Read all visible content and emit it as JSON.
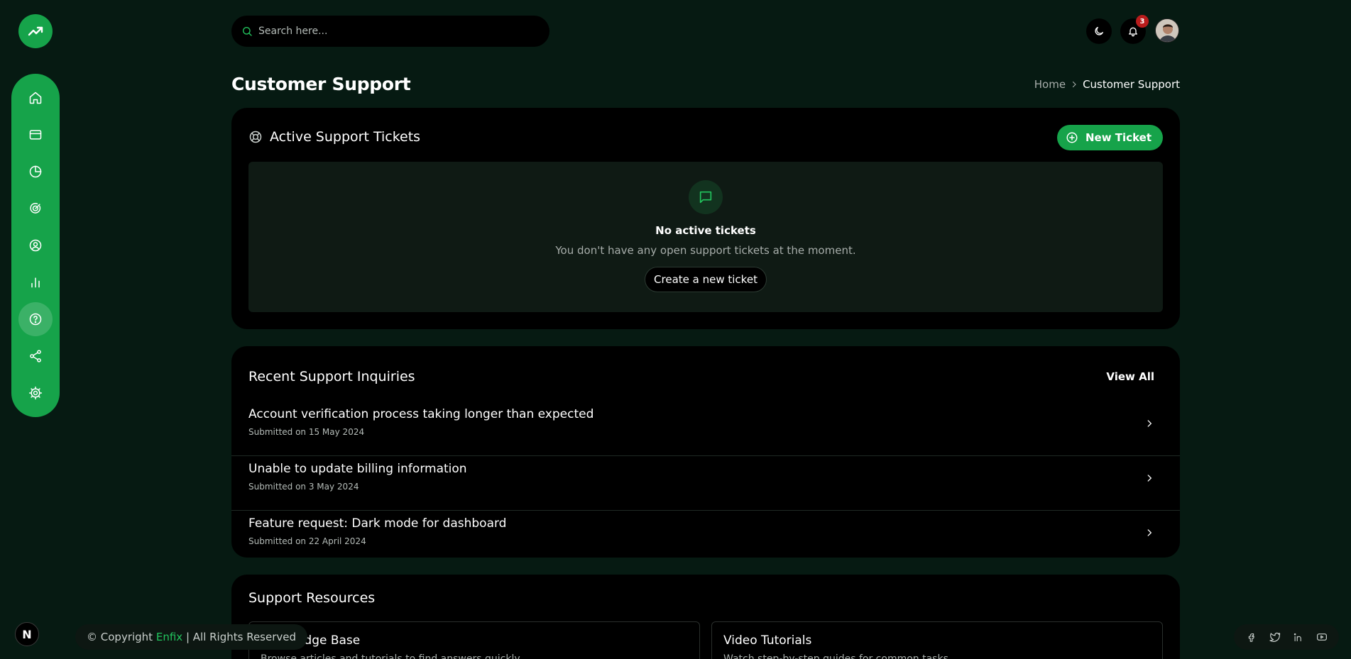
{
  "search": {
    "placeholder": "Search here..."
  },
  "header": {
    "notification_count": "3"
  },
  "page": {
    "title": "Customer Support",
    "breadcrumb": {
      "home": "Home",
      "separator": ">",
      "current": "Customer Support"
    }
  },
  "sidebar": {
    "items": [
      {
        "name": "home-icon"
      },
      {
        "name": "credit-card-icon"
      },
      {
        "name": "pie-chart-icon"
      },
      {
        "name": "radar-icon"
      },
      {
        "name": "user-circle-icon"
      },
      {
        "name": "bar-chart-icon"
      },
      {
        "name": "help-circle-icon",
        "active": true
      },
      {
        "name": "share-icon"
      },
      {
        "name": "settings-icon"
      }
    ]
  },
  "tickets": {
    "title": "Active Support Tickets",
    "new_ticket_label": "New Ticket",
    "empty_title": "No active tickets",
    "empty_subtitle": "You don't have any open support tickets at the moment.",
    "create_label": "Create a new ticket"
  },
  "inquiries": {
    "title": "Recent Support Inquiries",
    "view_all_label": "View All",
    "items": [
      {
        "title": "Account verification process taking longer than expected",
        "date": "Submitted on 15 May 2024"
      },
      {
        "title": "Unable to update billing information",
        "date": "Submitted on 3 May 2024"
      },
      {
        "title": "Feature request: Dark mode for dashboard",
        "date": "Submitted on 22 April 2024"
      }
    ]
  },
  "resources": {
    "title": "Support Resources",
    "items": [
      {
        "title": "Knowledge Base",
        "description": "Browse articles and tutorials to find answers quickly"
      },
      {
        "title": "Video Tutorials",
        "description": "Watch step-by-step guides for common tasks"
      }
    ]
  },
  "footer": {
    "copyright_prefix": "© Copyright",
    "brand": "Enfix",
    "copyright_suffix": "| All Rights Reserved",
    "next_badge": "N"
  },
  "colors": {
    "background": "#061a12",
    "accent": "#16a34a",
    "card": "#000000",
    "badge": "#b91c1c"
  }
}
